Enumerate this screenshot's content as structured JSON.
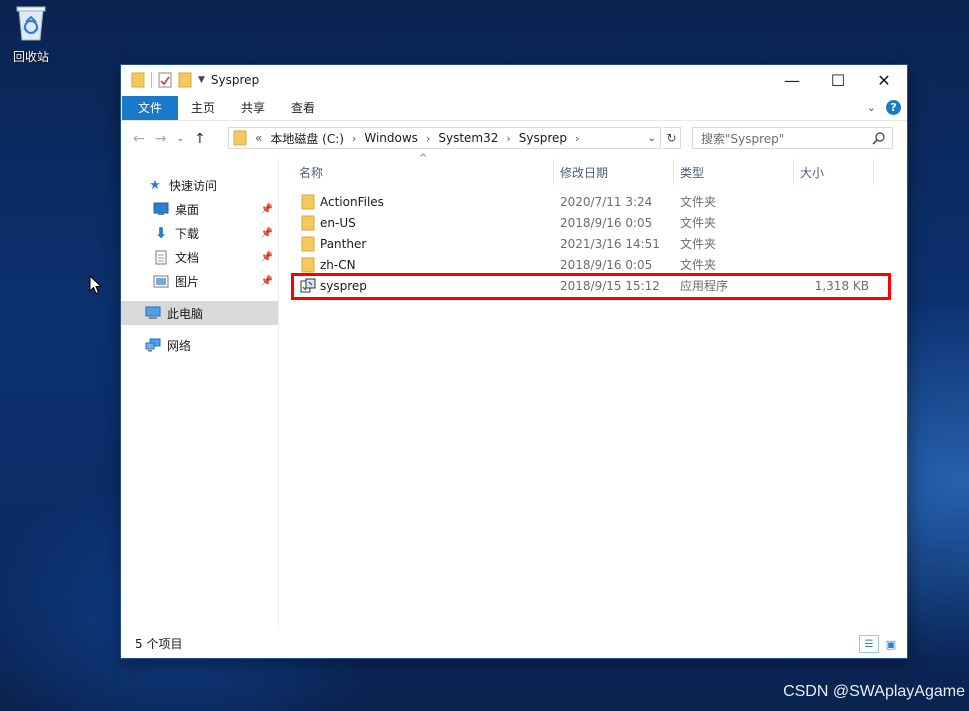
{
  "desktop": {
    "recycle_bin_label": "回收站",
    "watermark": "CSDN @SWAplayAgame"
  },
  "window": {
    "title": "Sysprep",
    "controls": {
      "minimize": "—",
      "maximize": "☐",
      "close": "✕"
    }
  },
  "ribbon": {
    "tabs": [
      "文件",
      "主页",
      "共享",
      "查看"
    ]
  },
  "address": {
    "prefix": "«",
    "crumbs": [
      "本地磁盘 (C:)",
      "Windows",
      "System32",
      "Sysprep"
    ],
    "separator": "›"
  },
  "search": {
    "placeholder": "搜索\"Sysprep\""
  },
  "nav": {
    "quick_access": "快速访问",
    "items": [
      "桌面",
      "下载",
      "文档",
      "图片"
    ],
    "this_pc": "此电脑",
    "network": "网络"
  },
  "columns": {
    "name": "名称",
    "date": "修改日期",
    "type": "类型",
    "size": "大小"
  },
  "files": [
    {
      "name": "ActionFiles",
      "date": "2020/7/11 3:24",
      "type": "文件夹",
      "size": "",
      "icon": "folder-icon"
    },
    {
      "name": "en-US",
      "date": "2018/9/16 0:05",
      "type": "文件夹",
      "size": "",
      "icon": "folder-icon"
    },
    {
      "name": "Panther",
      "date": "2021/3/16 14:51",
      "type": "文件夹",
      "size": "",
      "icon": "folder-icon"
    },
    {
      "name": "zh-CN",
      "date": "2018/9/16 0:05",
      "type": "文件夹",
      "size": "",
      "icon": "folder-icon"
    },
    {
      "name": "sysprep",
      "date": "2018/9/15 15:12",
      "type": "应用程序",
      "size": "1,318 KB",
      "icon": "application-icon"
    }
  ],
  "status": {
    "item_count": "5 个项目"
  },
  "colors": {
    "accent": "#1979ca",
    "highlight_box": "#ff0000",
    "folder": "#f4c95d"
  }
}
